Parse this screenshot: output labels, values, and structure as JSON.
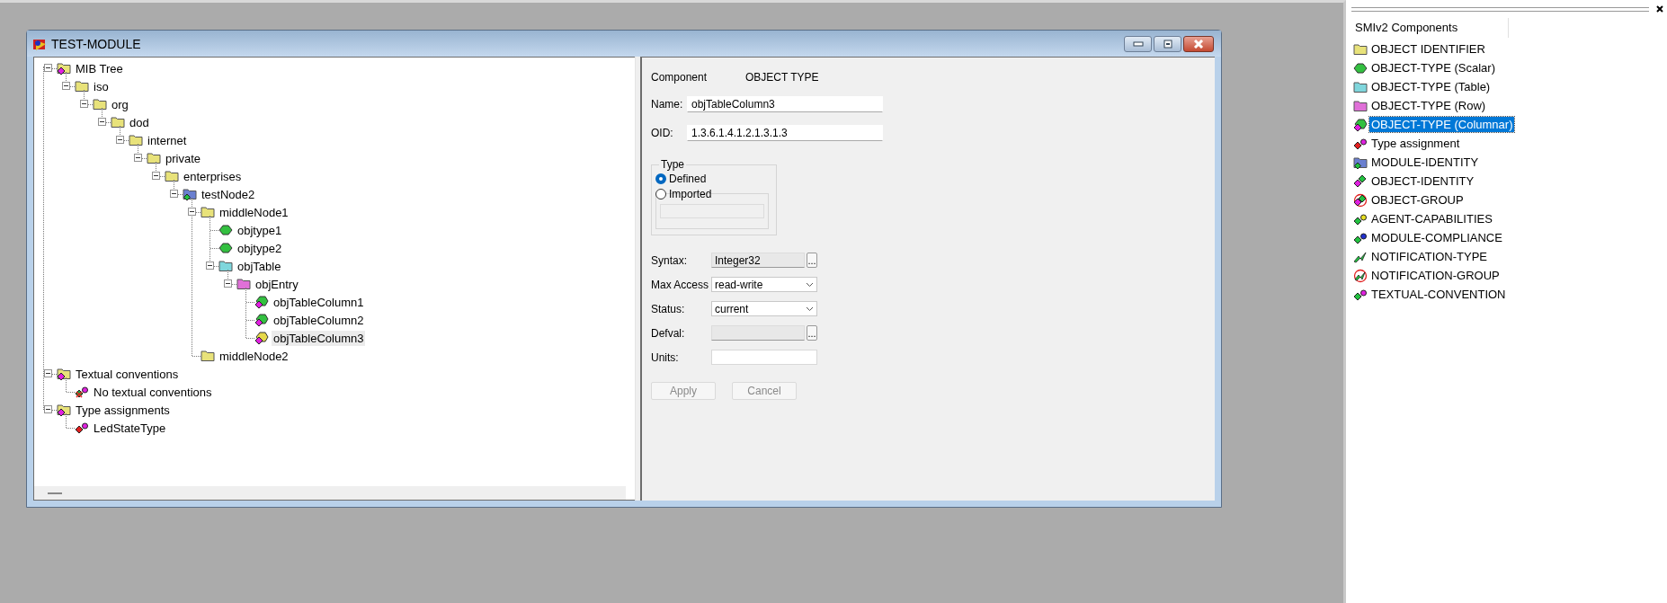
{
  "window": {
    "title": "TEST-MODULE"
  },
  "tree": [
    {
      "label": "MIB Tree",
      "kind": "root",
      "expanded": true,
      "selected": false,
      "children": [
        {
          "label": "iso",
          "kind": "folder",
          "expanded": true,
          "selected": false,
          "children": [
            {
              "label": "org",
              "kind": "folder",
              "expanded": true,
              "selected": false,
              "children": [
                {
                  "label": "dod",
                  "kind": "folder",
                  "expanded": true,
                  "selected": false,
                  "children": [
                    {
                      "label": "internet",
                      "kind": "folder",
                      "expanded": true,
                      "selected": false,
                      "children": [
                        {
                          "label": "private",
                          "kind": "folder",
                          "expanded": true,
                          "selected": false,
                          "children": [
                            {
                              "label": "enterprises",
                              "kind": "folder",
                              "expanded": true,
                              "selected": false,
                              "children": [
                                {
                                  "label": "testNode2",
                                  "kind": "module",
                                  "expanded": true,
                                  "selected": false,
                                  "children": [
                                    {
                                      "label": "middleNode1",
                                      "kind": "folder",
                                      "expanded": true,
                                      "selected": false,
                                      "children": [
                                        {
                                          "label": "objtype1",
                                          "kind": "scalar",
                                          "selected": false
                                        },
                                        {
                                          "label": "objtype2",
                                          "kind": "scalar",
                                          "selected": false
                                        },
                                        {
                                          "label": "objTable",
                                          "kind": "table",
                                          "expanded": true,
                                          "selected": false,
                                          "children": [
                                            {
                                              "label": "objEntry",
                                              "kind": "row",
                                              "expanded": true,
                                              "selected": false,
                                              "children": [
                                                {
                                                  "label": "objTableColumn1",
                                                  "kind": "column",
                                                  "selected": false
                                                },
                                                {
                                                  "label": "objTableColumn2",
                                                  "kind": "column",
                                                  "selected": false
                                                },
                                                {
                                                  "label": "objTableColumn3",
                                                  "kind": "column",
                                                  "selected": true
                                                }
                                              ]
                                            }
                                          ]
                                        }
                                      ]
                                    },
                                    {
                                      "label": "middleNode2",
                                      "kind": "folder",
                                      "selected": false
                                    }
                                  ]
                                }
                              ]
                            }
                          ]
                        }
                      ]
                    }
                  ]
                }
              ]
            }
          ]
        }
      ]
    },
    {
      "label": "Textual conventions",
      "kind": "root",
      "expanded": true,
      "selected": false,
      "children": [
        {
          "label": "No textual conventions",
          "kind": "none",
          "selected": false
        }
      ]
    },
    {
      "label": "Type assignments",
      "kind": "root",
      "expanded": true,
      "selected": false,
      "children": [
        {
          "label": "LedStateType",
          "kind": "type",
          "selected": false
        }
      ]
    }
  ],
  "form": {
    "component_label": "Component",
    "component_value": "OBJECT TYPE",
    "fields": [
      {
        "label": "Name:",
        "value": "objTableColumn3",
        "disabled": false
      },
      {
        "label": "OID:",
        "value": "1.3.6.1.4.1.2.1.3.1.3",
        "disabled": false
      }
    ],
    "type_group": {
      "title": "Type",
      "options": [
        {
          "label": "Defined",
          "selected": true
        },
        {
          "label": "Imported",
          "selected": false
        }
      ]
    },
    "attributes": [
      {
        "kind": "browse",
        "label": "Syntax:",
        "value": "Integer32",
        "disabled": true,
        "button": "..."
      },
      {
        "kind": "select",
        "label": "Max Access",
        "value": "read-write"
      },
      {
        "kind": "select",
        "label": "Status:",
        "value": "current"
      },
      {
        "kind": "browse",
        "label": "Defval:",
        "disabled": true,
        "button": "..."
      },
      {
        "kind": "text",
        "label": "Units:",
        "disabled": false
      }
    ],
    "buttons": [
      {
        "label": "Apply",
        "disabled": true
      },
      {
        "label": "Cancel",
        "disabled": true
      }
    ]
  },
  "components_panel": {
    "header": "SMIv2 Components",
    "items": [
      {
        "label": "OBJECT IDENTIFIER",
        "kind": "folder",
        "selected": false
      },
      {
        "label": "OBJECT-TYPE (Scalar)",
        "kind": "scalar",
        "selected": false
      },
      {
        "label": "OBJECT-TYPE (Table)",
        "kind": "table",
        "selected": false
      },
      {
        "label": "OBJECT-TYPE (Row)",
        "kind": "row",
        "selected": false
      },
      {
        "label": "OBJECT-TYPE (Columnar)",
        "kind": "column",
        "selected": true
      },
      {
        "label": "Type assignment",
        "kind": "type",
        "selected": false
      },
      {
        "label": "MODULE-IDENTITY",
        "kind": "module",
        "selected": false
      },
      {
        "label": "OBJECT-IDENTITY",
        "kind": "identity",
        "selected": false
      },
      {
        "label": "OBJECT-GROUP",
        "kind": "group",
        "selected": false
      },
      {
        "label": "AGENT-CAPABILITIES",
        "kind": "agent",
        "selected": false
      },
      {
        "label": "MODULE-COMPLIANCE",
        "kind": "compliance",
        "selected": false
      },
      {
        "label": "NOTIFICATION-TYPE",
        "kind": "notification",
        "selected": false
      },
      {
        "label": "NOTIFICATION-GROUP",
        "kind": "notification-group",
        "selected": false
      },
      {
        "label": "TEXTUAL-CONVENTION",
        "kind": "textual",
        "selected": false
      }
    ]
  }
}
